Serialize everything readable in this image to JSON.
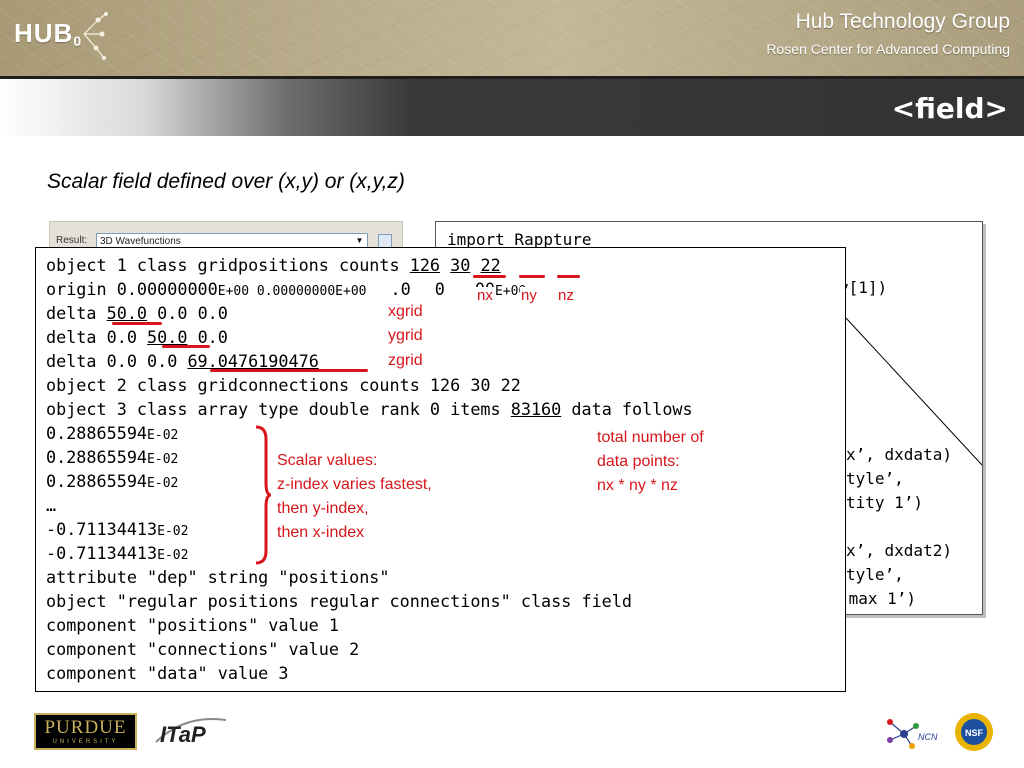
{
  "header": {
    "logo_text": "HUB",
    "logo_sub": "0",
    "org_name": "Hub Technology Group",
    "org_subtitle": "Rosen Center for Advanced Computing"
  },
  "slide": {
    "title": "<field>",
    "subtitle": "Scalar field defined over (x,y) or (x,y,z)"
  },
  "screenshot": {
    "result_label": "Result:",
    "result_value": "3D Wavefunctions"
  },
  "right_code": {
    "lines": [
      "import Rappture",
      "y[1])",
      "x’, dxdata)",
      "tyle’,",
      "tity 1’)",
      "x’, dxdat2)",
      "tyle’,",
      "-max 1’)"
    ]
  },
  "code": {
    "line1_pre": "object 1 class gridpositions counts ",
    "nx": "126",
    "ny": "30",
    "nz": "22",
    "line2_a": "origin 0.00000000",
    "line2_b": "E+00 0.00000000",
    "line2_c": "E+00",
    "line2_d": ".0",
    "line2_e": "0",
    "line2_f": "00",
    "line2_g": "E+00",
    "line3_pre": "delta ",
    "dx": "50.0",
    "line3_post": " 0.0 0.0",
    "line4_pre": "delta 0.0 ",
    "dy": "50.0",
    "line4_post": " 0.0",
    "line5_pre": "delta 0.0 0.0 ",
    "dz": "69.0476190476",
    "line6": "object 2 class gridconnections counts 126 30 22",
    "line7_pre": "object 3 class array type double rank 0 items ",
    "items": "83160",
    "line7_post": " data follows",
    "val1_a": "0.28865594",
    "val1_b": "E-02",
    "val2_a": "0.28865594",
    "val2_b": "E-02",
    "val3_a": "0.28865594",
    "val3_b": "E-02",
    "ellipsis": "…",
    "val4_a": "-0.71134413",
    "val4_b": "E-02",
    "val5_a": "-0.71134413",
    "val5_b": "E-02",
    "line_attr": "attribute \"dep\" string \"positions\"",
    "line_obj": "object \"regular positions regular connections\" class field",
    "line_c1": "component \"positions\" value 1",
    "line_c2": "component \"connections\" value 2",
    "line_c3": "component \"data\" value 3"
  },
  "annotations": {
    "nx": "nx",
    "ny": "ny",
    "nz": "nz",
    "xgrid": "xgrid",
    "ygrid": "ygrid",
    "zgrid": "zgrid",
    "scalar": [
      "Scalar values:",
      "z-index varies fastest,",
      "then y-index,",
      "then x-index"
    ],
    "total": [
      "total number of",
      "data points:",
      "nx * ny * nz"
    ]
  },
  "footer": {
    "purdue": "PURDUE",
    "purdue_sub": "UNIVERSITY",
    "itap": "ITaP",
    "ncn": "NCN",
    "nsf": "NSF"
  },
  "colors": {
    "accent_red": "#d7151b",
    "title_band": "#333333",
    "header_band": "#b9ac8a"
  }
}
